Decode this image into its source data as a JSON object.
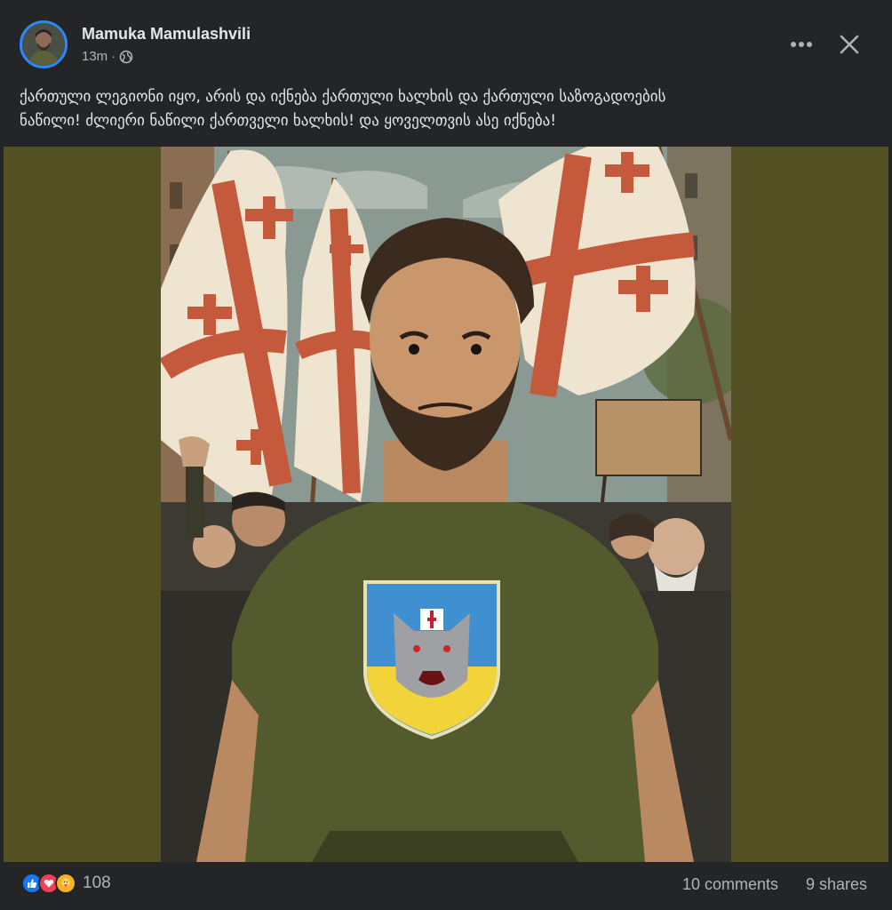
{
  "post": {
    "author": "Mamuka Mamulashvili",
    "time": "13m",
    "separator": "·",
    "text_line1": "ქართული ლეგიონი იყო, არის და იქნება ქართული ხალხის და ქართული საზოგადოების",
    "text_line2": "ნაწილი! ძლიერი ნაწილი ქართველი ხალხის! და ყოველთვის ასე იქნება!",
    "reactions": {
      "icons": [
        "like-icon",
        "love-icon",
        "care-icon"
      ],
      "count": "108"
    },
    "comments": "10 comments",
    "shares": "9 shares"
  },
  "colors": {
    "background": "#242526",
    "accent": "#2d88ff",
    "image_letterbox": "#535124",
    "shirt": "#525a2e"
  },
  "image": {
    "icons": [
      "georgian-flag-icon",
      "protest-sign-icon",
      "ukraine-wolf-patch-icon"
    ]
  }
}
